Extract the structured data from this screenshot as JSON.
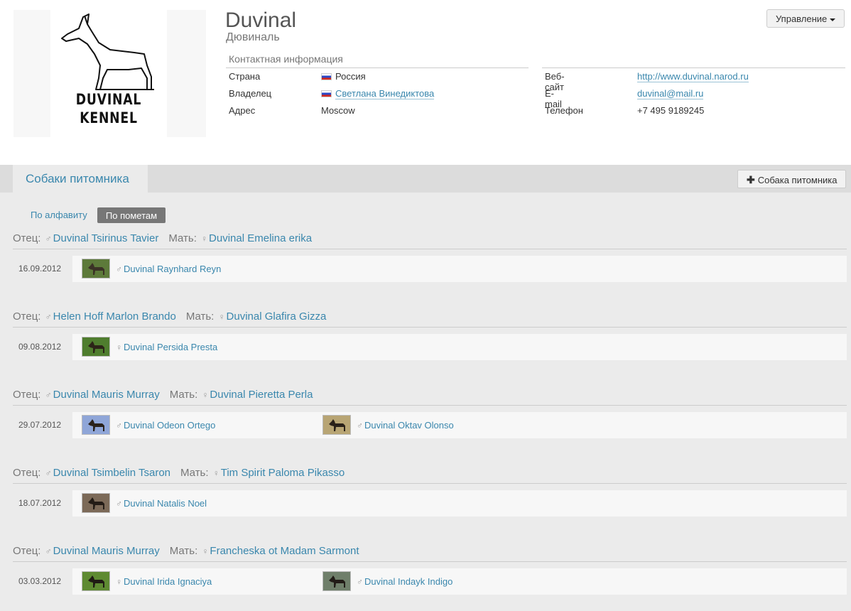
{
  "kennel": {
    "name": "Duvinal",
    "subname": "Дювиналь",
    "logo_text_line1": "DUVINAL",
    "logo_text_line2": "KENNEL"
  },
  "manage_button": "Управление",
  "contacts": {
    "header": "Контактная информация",
    "country_label": "Страна",
    "country_value": "Россия",
    "owner_label": "Владелец",
    "owner_value": "Светлана Винедиктова",
    "address_label": "Адрес",
    "address_value": "Moscow",
    "website_label": "Веб-сайт",
    "website_value": "http://www.duvinal.narod.ru",
    "email_label": "E-mail",
    "email_value": "duvinal@mail.ru",
    "phone_label": "Телефон",
    "phone_value": "+7 495 9189245"
  },
  "tabs": {
    "active": "Собаки питомника",
    "add_button": "Собака питомника"
  },
  "sort": {
    "alpha": "По алфавиту",
    "litter": "По пометам"
  },
  "litter_labels": {
    "father": "Отец:",
    "mother": "Мать:"
  },
  "icons": {
    "male": "♂",
    "female": "♀"
  },
  "colors": {
    "link": "#3a87ad",
    "tab_bar": "#dcdcdc",
    "background": "#ebebeb"
  },
  "litters": [
    {
      "father": "Duvinal Tsirinus Tavier",
      "mother": "Duvinal Emelina erika",
      "date": "16.09.2012",
      "pups": [
        {
          "sex": "male",
          "name": "Duvinal Raynhard Reyn"
        }
      ]
    },
    {
      "father": "Helen Hoff Marlon Brando",
      "mother": "Duvinal Glafira Gizza",
      "date": "09.08.2012",
      "pups": [
        {
          "sex": "female",
          "name": "Duvinal Persida Presta"
        }
      ]
    },
    {
      "father": "Duvinal Mauris Murray",
      "mother": "Duvinal Pieretta Perla",
      "date": "29.07.2012",
      "pups": [
        {
          "sex": "male",
          "name": "Duvinal Odeon Ortego"
        },
        {
          "sex": "male",
          "name": "Duvinal Oktav Olonso"
        }
      ]
    },
    {
      "father": "Duvinal Tsimbelin Tsaron",
      "mother": "Tim Spirit Paloma Pikasso",
      "date": "18.07.2012",
      "pups": [
        {
          "sex": "male",
          "name": "Duvinal Natalis Noel"
        }
      ]
    },
    {
      "father": "Duvinal Mauris Murray",
      "mother": "Francheska ot Madam Sarmont",
      "date": "03.03.2012",
      "pups": [
        {
          "sex": "female",
          "name": "Duvinal Irida Ignaciya"
        },
        {
          "sex": "male",
          "name": "Duvinal Indayk Indigo"
        }
      ]
    }
  ]
}
